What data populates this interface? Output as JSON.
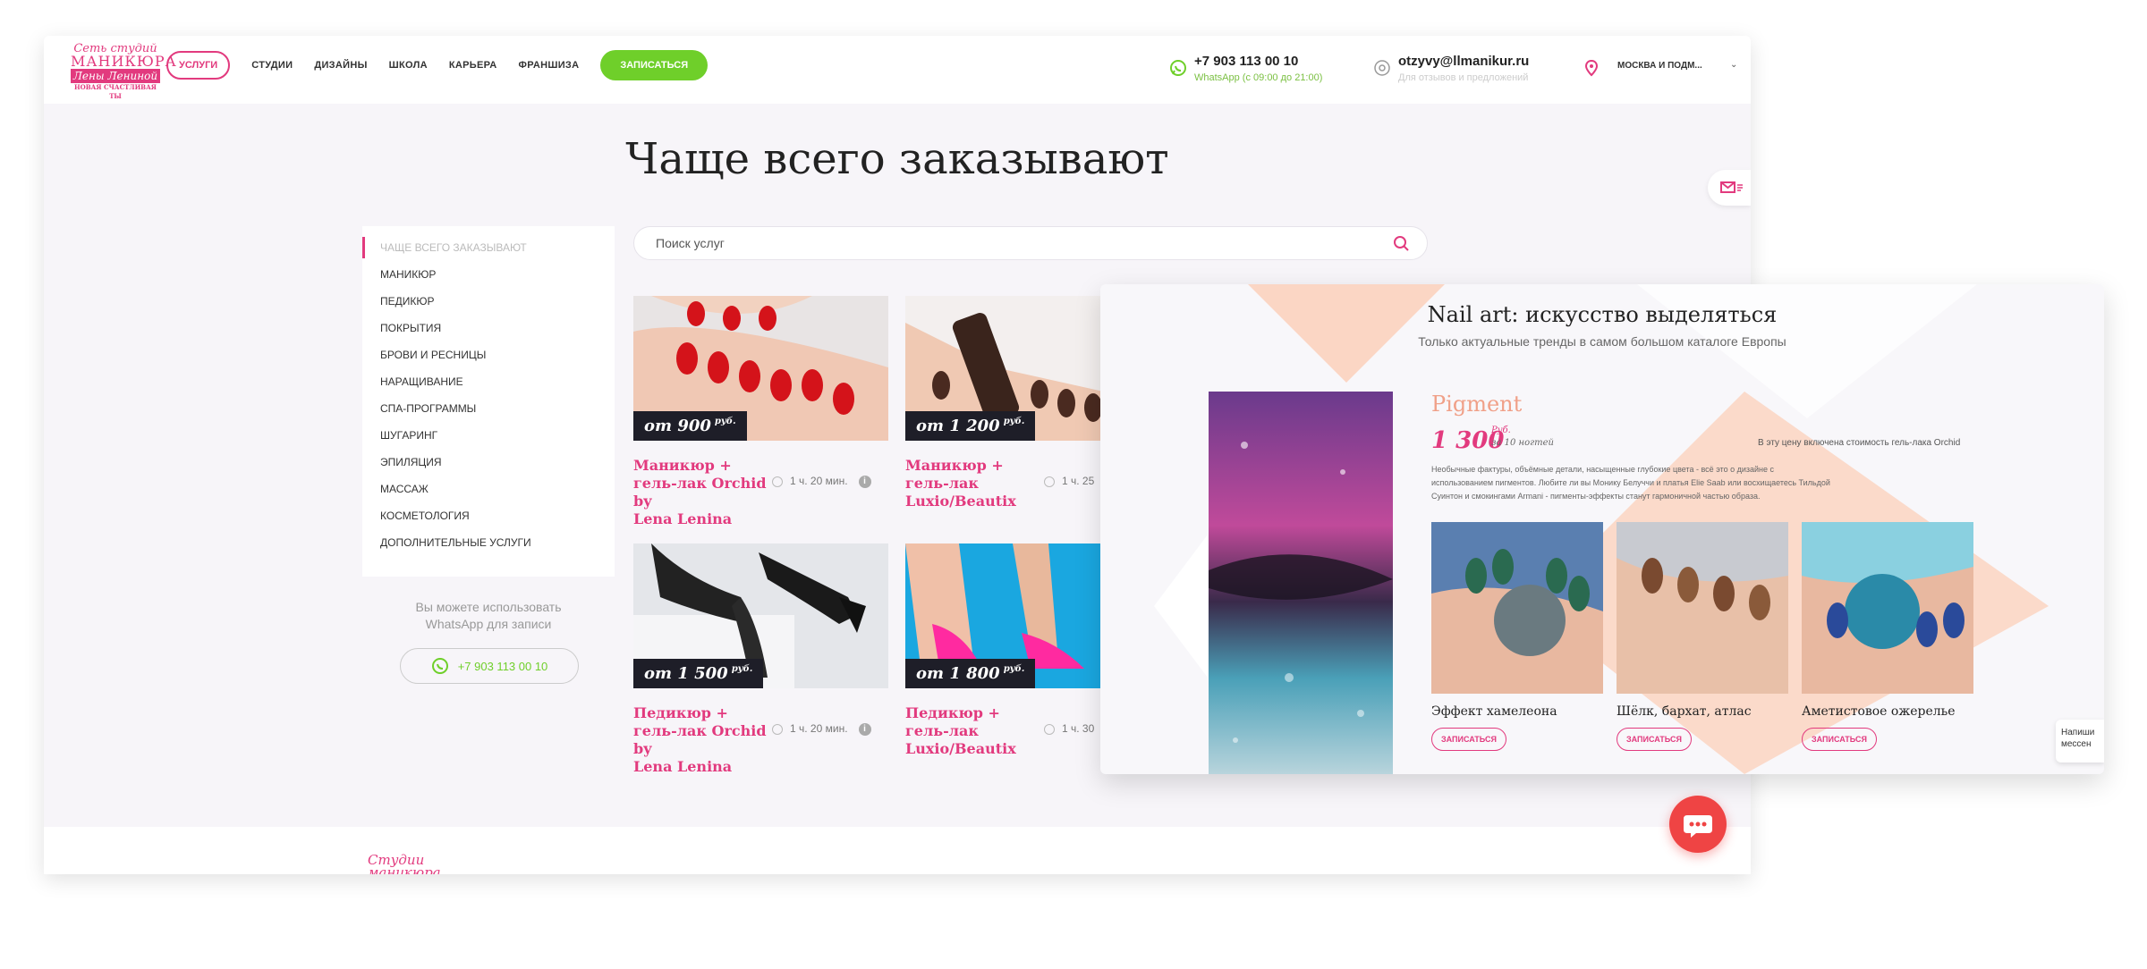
{
  "header": {
    "logo": {
      "line1": "Сеть студий",
      "line2": "МАНИКЮРА",
      "line3": "Лены Лениной",
      "tagline": "НОВАЯ СЧАСТЛИВАЯ ТЫ"
    },
    "nav": {
      "active": "УСЛУГИ",
      "items": [
        "СТУДИИ",
        "ДИЗАЙНЫ",
        "ШКОЛА",
        "КАРЬЕРА",
        "ФРАНШИЗА"
      ],
      "cta": "ЗАПИСАТЬСЯ"
    },
    "phone": "+7 903 113 00 10",
    "phone_note": "WhatsApp (с 09:00 до 21:00)",
    "email": "otzyvy@llmanikur.ru",
    "email_note": "Для отзывов и предложений",
    "city": "МОСКВА И ПОДМ..."
  },
  "page_title": "Чаще всего заказывают",
  "sidebar": {
    "items": [
      "ЧАЩЕ ВСЕГО ЗАКАЗЫВАЮТ",
      "МАНИКЮР",
      "ПЕДИКЮР",
      "ПОКРЫТИЯ",
      "БРОВИ И РЕСНИЦЫ",
      "НАРАЩИВАНИЕ",
      "СПА-ПРОГРАММЫ",
      "ШУГАРИНГ",
      "ЭПИЛЯЦИЯ",
      "МАССАЖ",
      "КОСМЕТОЛОГИЯ",
      "ДОПОЛНИТЕЛЬНЫЕ УСЛУГИ"
    ],
    "whatsapp_text_1": "Вы можете использовать",
    "whatsapp_text_2": "WhatsApp для записи",
    "whatsapp_phone": "+7 903 113 00 10"
  },
  "search": {
    "placeholder": "Поиск услуг"
  },
  "cards": [
    {
      "price": "от 900",
      "currency": "руб.",
      "title_1": "Маникюр + гель-лак Orchid by",
      "title_2": "Lena Lenina",
      "time": "1 ч. 20 мин."
    },
    {
      "price": "от 1 200",
      "currency": "руб.",
      "title_1": "Маникюр + гель-лак",
      "title_2": "Luxio/Beautix",
      "time": "1 ч. 25"
    },
    {
      "price": "от 1 500",
      "currency": "руб.",
      "title_1": "Педикюр + гель-лак Orchid by",
      "title_2": "Lena Lenina",
      "time": "1 ч. 20 мин."
    },
    {
      "price": "от 1 800",
      "currency": "руб.",
      "title_1": "Педикюр + гель-лак",
      "title_2": "Luxio/Beautix",
      "time": "1 ч. 30"
    }
  ],
  "footer": {
    "logo_1": "Студии",
    "logo_2": "маникюра"
  },
  "overlay": {
    "title": "Nail art: искусство выделяться",
    "subtitle": "Только актуальные тренды в самом большом каталоге Европы",
    "pigment": {
      "name": "Pigment",
      "price": "1 300",
      "currency": "Руб.",
      "unit": "за 10 ногтей",
      "note": "В эту цену включена стоимость гель-лака Orchid",
      "desc_1": "Необычные фактуры, объёмные детали, насыщенные глубокие цвета - всё это о дизайне с",
      "desc_2": "использованием пигментов. Любите ли вы Монику Белуччи и платья Elie Saab или восхищаетесь Тильдой",
      "desc_3": "Суинтон и смокингами Armani - пигменты-эффекты станут гармоничной частью образа."
    },
    "designs": [
      {
        "name": "Эффект хамелеона",
        "button": "ЗАПИСАТЬСЯ"
      },
      {
        "name": "Шёлк, бархат, атлас",
        "button": "ЗАПИСАТЬСЯ"
      },
      {
        "name": "Аметистовое ожерелье",
        "button": "ЗАПИСАТЬСЯ"
      }
    ],
    "chat_text_1": "Напиши",
    "chat_text_2": "мессен"
  },
  "colors": {
    "accent": "#e23a7e",
    "whatsapp": "#6fcf2a",
    "chat_fab": "#ef4444"
  }
}
